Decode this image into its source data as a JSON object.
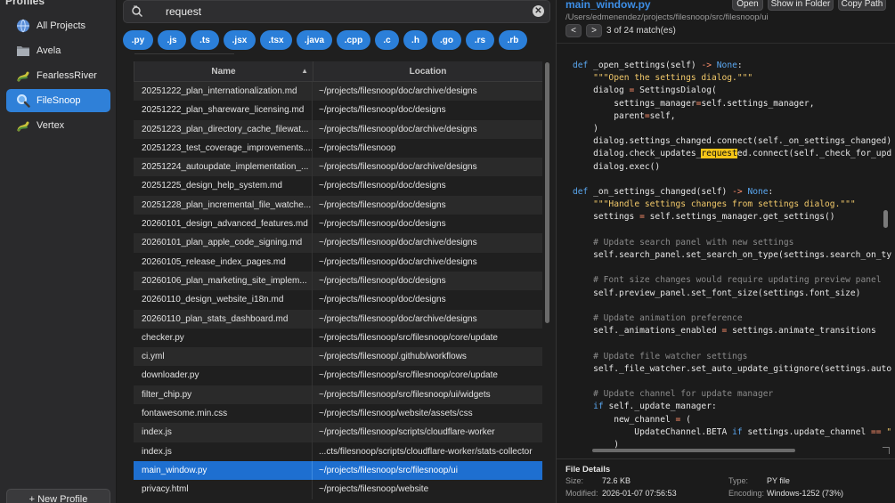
{
  "sidebar": {
    "title": "Profiles",
    "profiles": [
      {
        "label": "All Projects",
        "icon": "globe-icon",
        "active": false
      },
      {
        "label": "Avela",
        "icon": "folder-icon",
        "active": false
      },
      {
        "label": "FearlessRiver",
        "icon": "python-icon",
        "active": false
      },
      {
        "label": "FileSnoop",
        "icon": "magnifier-icon",
        "active": true
      },
      {
        "label": "Vertex",
        "icon": "python-icon",
        "active": false
      }
    ],
    "new_profile_label": "+ New Profile"
  },
  "search": {
    "value": "request",
    "icon": "search-scope-icon",
    "clear_icon": "clear-icon"
  },
  "filters": [
    ".py",
    ".js",
    ".ts",
    ".jsx",
    ".tsx",
    ".java",
    ".cpp",
    ".c",
    ".h",
    ".go",
    ".rs",
    ".rb"
  ],
  "results": {
    "columns": {
      "name": "Name",
      "location": "Location"
    },
    "rows": [
      {
        "name": "20251222_plan_internationalization.md",
        "location": "~/projects/filesnoop/doc/archive/designs"
      },
      {
        "name": "20251222_plan_shareware_licensing.md",
        "location": "~/projects/filesnoop/doc/designs"
      },
      {
        "name": "20251223_plan_directory_cache_filewat...",
        "location": "~/projects/filesnoop/doc/archive/designs"
      },
      {
        "name": "20251223_test_coverage_improvements....",
        "location": "~/projects/filesnoop"
      },
      {
        "name": "20251224_autoupdate_implementation_...",
        "location": "~/projects/filesnoop/doc/archive/designs"
      },
      {
        "name": "20251225_design_help_system.md",
        "location": "~/projects/filesnoop/doc/designs"
      },
      {
        "name": "20251228_plan_incremental_file_watche...",
        "location": "~/projects/filesnoop/doc/designs"
      },
      {
        "name": "20260101_design_advanced_features.md",
        "location": "~/projects/filesnoop/doc/designs"
      },
      {
        "name": "20260101_plan_apple_code_signing.md",
        "location": "~/projects/filesnoop/doc/archive/designs"
      },
      {
        "name": "20260105_release_index_pages.md",
        "location": "~/projects/filesnoop/doc/archive/designs"
      },
      {
        "name": "20260106_plan_marketing_site_implem...",
        "location": "~/projects/filesnoop/doc/designs"
      },
      {
        "name": "20260110_design_website_i18n.md",
        "location": "~/projects/filesnoop/doc/designs"
      },
      {
        "name": "20260110_plan_stats_dashboard.md",
        "location": "~/projects/filesnoop/doc/archive/designs"
      },
      {
        "name": "checker.py",
        "location": "~/projects/filesnoop/src/filesnoop/core/update"
      },
      {
        "name": "ci.yml",
        "location": "~/projects/filesnoop/.github/workflows"
      },
      {
        "name": "downloader.py",
        "location": "~/projects/filesnoop/src/filesnoop/core/update"
      },
      {
        "name": "filter_chip.py",
        "location": "~/projects/filesnoop/src/filesnoop/ui/widgets"
      },
      {
        "name": "fontawesome.min.css",
        "location": "~/projects/filesnoop/website/assets/css"
      },
      {
        "name": "index.js",
        "location": "~/projects/filesnoop/scripts/cloudflare-worker"
      },
      {
        "name": "index.js",
        "location": "...cts/filesnoop/scripts/cloudflare-worker/stats-collector"
      },
      {
        "name": "main_window.py",
        "location": "~/projects/filesnoop/src/filesnoop/ui",
        "selected": true
      },
      {
        "name": "privacy.html",
        "location": "~/projects/filesnoop/website"
      }
    ]
  },
  "preview": {
    "file_name": "main_window.py",
    "file_path": "/Users/edmenendez/projects/filesnoop/src/filesnoop/ui",
    "buttons": {
      "open": "Open",
      "show_in_folder": "Show in Folder",
      "copy_path": "Copy Path"
    },
    "prev_label": "<",
    "next_label": ">",
    "match_count": "3 of 24 match(es)",
    "highlight_term": "request"
  },
  "details": {
    "title": "File Details",
    "size_label": "Size:",
    "size_value": "72.6 KB",
    "type_label": "Type:",
    "type_value": "PY file",
    "modified_label": "Modified:",
    "modified_value": "2026-01-07 07:56:53",
    "encoding_label": "Encoding:",
    "encoding_value": "Windows-1252 (73%)"
  },
  "colors": {
    "accent": "#2b7fd9",
    "title_blue": "#3d8ee6",
    "highlight": "#f5c518"
  }
}
